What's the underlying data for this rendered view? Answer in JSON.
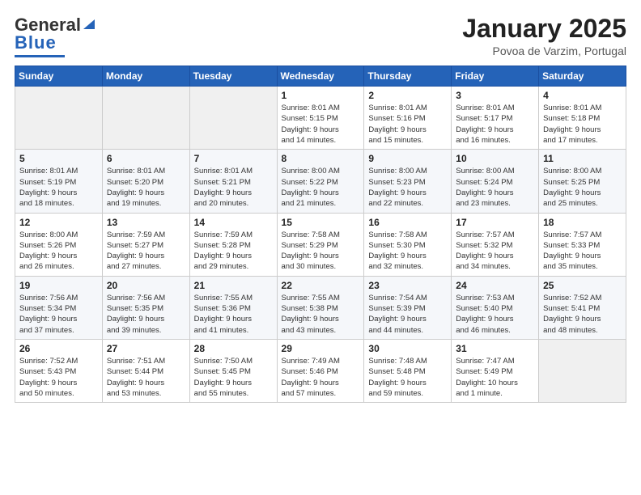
{
  "header": {
    "logo_general": "General",
    "logo_blue": "Blue",
    "month_title": "January 2025",
    "location": "Povoa de Varzim, Portugal"
  },
  "weekdays": [
    "Sunday",
    "Monday",
    "Tuesday",
    "Wednesday",
    "Thursday",
    "Friday",
    "Saturday"
  ],
  "weeks": [
    [
      {
        "day": "",
        "info": ""
      },
      {
        "day": "",
        "info": ""
      },
      {
        "day": "",
        "info": ""
      },
      {
        "day": "1",
        "info": "Sunrise: 8:01 AM\nSunset: 5:15 PM\nDaylight: 9 hours\nand 14 minutes."
      },
      {
        "day": "2",
        "info": "Sunrise: 8:01 AM\nSunset: 5:16 PM\nDaylight: 9 hours\nand 15 minutes."
      },
      {
        "day": "3",
        "info": "Sunrise: 8:01 AM\nSunset: 5:17 PM\nDaylight: 9 hours\nand 16 minutes."
      },
      {
        "day": "4",
        "info": "Sunrise: 8:01 AM\nSunset: 5:18 PM\nDaylight: 9 hours\nand 17 minutes."
      }
    ],
    [
      {
        "day": "5",
        "info": "Sunrise: 8:01 AM\nSunset: 5:19 PM\nDaylight: 9 hours\nand 18 minutes."
      },
      {
        "day": "6",
        "info": "Sunrise: 8:01 AM\nSunset: 5:20 PM\nDaylight: 9 hours\nand 19 minutes."
      },
      {
        "day": "7",
        "info": "Sunrise: 8:01 AM\nSunset: 5:21 PM\nDaylight: 9 hours\nand 20 minutes."
      },
      {
        "day": "8",
        "info": "Sunrise: 8:00 AM\nSunset: 5:22 PM\nDaylight: 9 hours\nand 21 minutes."
      },
      {
        "day": "9",
        "info": "Sunrise: 8:00 AM\nSunset: 5:23 PM\nDaylight: 9 hours\nand 22 minutes."
      },
      {
        "day": "10",
        "info": "Sunrise: 8:00 AM\nSunset: 5:24 PM\nDaylight: 9 hours\nand 23 minutes."
      },
      {
        "day": "11",
        "info": "Sunrise: 8:00 AM\nSunset: 5:25 PM\nDaylight: 9 hours\nand 25 minutes."
      }
    ],
    [
      {
        "day": "12",
        "info": "Sunrise: 8:00 AM\nSunset: 5:26 PM\nDaylight: 9 hours\nand 26 minutes."
      },
      {
        "day": "13",
        "info": "Sunrise: 7:59 AM\nSunset: 5:27 PM\nDaylight: 9 hours\nand 27 minutes."
      },
      {
        "day": "14",
        "info": "Sunrise: 7:59 AM\nSunset: 5:28 PM\nDaylight: 9 hours\nand 29 minutes."
      },
      {
        "day": "15",
        "info": "Sunrise: 7:58 AM\nSunset: 5:29 PM\nDaylight: 9 hours\nand 30 minutes."
      },
      {
        "day": "16",
        "info": "Sunrise: 7:58 AM\nSunset: 5:30 PM\nDaylight: 9 hours\nand 32 minutes."
      },
      {
        "day": "17",
        "info": "Sunrise: 7:57 AM\nSunset: 5:32 PM\nDaylight: 9 hours\nand 34 minutes."
      },
      {
        "day": "18",
        "info": "Sunrise: 7:57 AM\nSunset: 5:33 PM\nDaylight: 9 hours\nand 35 minutes."
      }
    ],
    [
      {
        "day": "19",
        "info": "Sunrise: 7:56 AM\nSunset: 5:34 PM\nDaylight: 9 hours\nand 37 minutes."
      },
      {
        "day": "20",
        "info": "Sunrise: 7:56 AM\nSunset: 5:35 PM\nDaylight: 9 hours\nand 39 minutes."
      },
      {
        "day": "21",
        "info": "Sunrise: 7:55 AM\nSunset: 5:36 PM\nDaylight: 9 hours\nand 41 minutes."
      },
      {
        "day": "22",
        "info": "Sunrise: 7:55 AM\nSunset: 5:38 PM\nDaylight: 9 hours\nand 43 minutes."
      },
      {
        "day": "23",
        "info": "Sunrise: 7:54 AM\nSunset: 5:39 PM\nDaylight: 9 hours\nand 44 minutes."
      },
      {
        "day": "24",
        "info": "Sunrise: 7:53 AM\nSunset: 5:40 PM\nDaylight: 9 hours\nand 46 minutes."
      },
      {
        "day": "25",
        "info": "Sunrise: 7:52 AM\nSunset: 5:41 PM\nDaylight: 9 hours\nand 48 minutes."
      }
    ],
    [
      {
        "day": "26",
        "info": "Sunrise: 7:52 AM\nSunset: 5:43 PM\nDaylight: 9 hours\nand 50 minutes."
      },
      {
        "day": "27",
        "info": "Sunrise: 7:51 AM\nSunset: 5:44 PM\nDaylight: 9 hours\nand 53 minutes."
      },
      {
        "day": "28",
        "info": "Sunrise: 7:50 AM\nSunset: 5:45 PM\nDaylight: 9 hours\nand 55 minutes."
      },
      {
        "day": "29",
        "info": "Sunrise: 7:49 AM\nSunset: 5:46 PM\nDaylight: 9 hours\nand 57 minutes."
      },
      {
        "day": "30",
        "info": "Sunrise: 7:48 AM\nSunset: 5:48 PM\nDaylight: 9 hours\nand 59 minutes."
      },
      {
        "day": "31",
        "info": "Sunrise: 7:47 AM\nSunset: 5:49 PM\nDaylight: 10 hours\nand 1 minute."
      },
      {
        "day": "",
        "info": ""
      }
    ]
  ]
}
